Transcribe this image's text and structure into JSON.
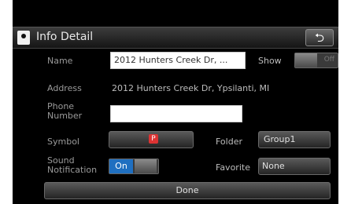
{
  "header": {
    "title": "Info Detail",
    "back_icon": "return-arrow-icon"
  },
  "form": {
    "name_label": "Name",
    "name_value": "2012 Hunters Creek Dr, ...",
    "show_label": "Show",
    "show_toggle_state": "Off",
    "address_label": "Address",
    "address_value": "2012 Hunters Creek Dr, Ypsilanti, MI",
    "phone_label_line1": "Phone",
    "phone_label_line2": "Number",
    "phone_value": "",
    "symbol_label": "Symbol",
    "symbol_icon": "map-pin-icon",
    "folder_label": "Folder",
    "folder_value": "Group1",
    "sound_label_line1": "Sound",
    "sound_label_line2": "Notification",
    "sound_toggle_state": "On",
    "favorite_label": "Favorite",
    "favorite_value": "None"
  },
  "footer": {
    "done_label": "Done"
  },
  "colors": {
    "accent": "#1f6fc0",
    "background": "#000000"
  }
}
